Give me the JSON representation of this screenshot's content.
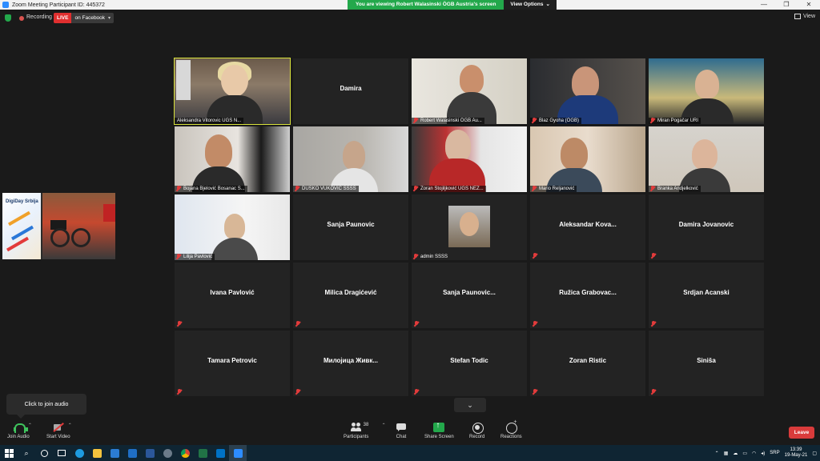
{
  "titlebar": {
    "title": "Zoom Meeting Participant ID: 445372"
  },
  "share_banner": {
    "viewing": "You are viewing Robert Walasinski ÖGB Austria's screen",
    "view_options": "View Options"
  },
  "status": {
    "recording": "Recording",
    "live": "LIVE",
    "destination": "on Facebook",
    "view": "View"
  },
  "shared_content": {
    "slide_title": "DigiDay Srbija"
  },
  "gallery": {
    "tiles": [
      {
        "name": "Aleksandra Vitorovic UGS N...",
        "type": "video",
        "muted": false
      },
      {
        "name": "Damira",
        "type": "name",
        "muted": false
      },
      {
        "name": "Robert Walasinski ÖGB Au...",
        "type": "video",
        "muted": true
      },
      {
        "name": "Blaz Gyoha (ÖGB)",
        "type": "video",
        "muted": true
      },
      {
        "name": "Miran Pogačar URI",
        "type": "video",
        "muted": true
      },
      {
        "name": "Bojana Bjelović Bosanac S...",
        "type": "video",
        "muted": true
      },
      {
        "name": "DUŠKO VUKOVIĆ SSSS",
        "type": "video",
        "muted": true
      },
      {
        "name": "Zoran Stojiljković UGS NEZ...",
        "type": "video",
        "muted": true
      },
      {
        "name": "Mario Reljanović",
        "type": "video",
        "muted": true
      },
      {
        "name": "Branka Andjelković",
        "type": "video",
        "muted": true
      },
      {
        "name": "Lilija Pavlović",
        "type": "video",
        "muted": true
      },
      {
        "name": "Sanja Paunovic",
        "type": "name",
        "muted": false
      },
      {
        "name": "admin SSSS",
        "type": "photo",
        "muted": true
      },
      {
        "name": "Aleksandar Kova...",
        "type": "name",
        "muted": true
      },
      {
        "name": "Damira Jovanovic",
        "type": "name",
        "muted": true
      },
      {
        "name": "Ivana Pavlović",
        "type": "name",
        "muted": true
      },
      {
        "name": "Milica Dragićević",
        "type": "name",
        "muted": true
      },
      {
        "name": "Sanja Paunovic...",
        "type": "name",
        "muted": true
      },
      {
        "name": "Ružica Grabovac...",
        "type": "name",
        "muted": true
      },
      {
        "name": "Srdjan Acanski",
        "type": "name",
        "muted": true
      },
      {
        "name": "Tamara Petrovic",
        "type": "name",
        "muted": true
      },
      {
        "name": "Милојица Живк...",
        "type": "name",
        "muted": true
      },
      {
        "name": "Stefan Todic",
        "type": "name",
        "muted": true
      },
      {
        "name": "Zoran Ristic",
        "type": "name",
        "muted": true
      },
      {
        "name": "Siniša",
        "type": "name",
        "muted": true
      }
    ]
  },
  "tooltip": {
    "text": "Click to join audio"
  },
  "toolbar": {
    "join_audio": "Join Audio",
    "start_video": "Start Video",
    "participants": "Participants",
    "participant_count": "38",
    "chat": "Chat",
    "share_screen": "Share Screen",
    "record": "Record",
    "reactions": "Reactions",
    "leave": "Leave"
  },
  "taskbar": {
    "lang": "SRP",
    "time": "13:39",
    "date": "19-May-21"
  },
  "colors": {
    "accent_green": "#23a84b",
    "live_red": "#e02f2f",
    "leave_red": "#d93b3b",
    "active_speaker": "#d8e23b"
  }
}
